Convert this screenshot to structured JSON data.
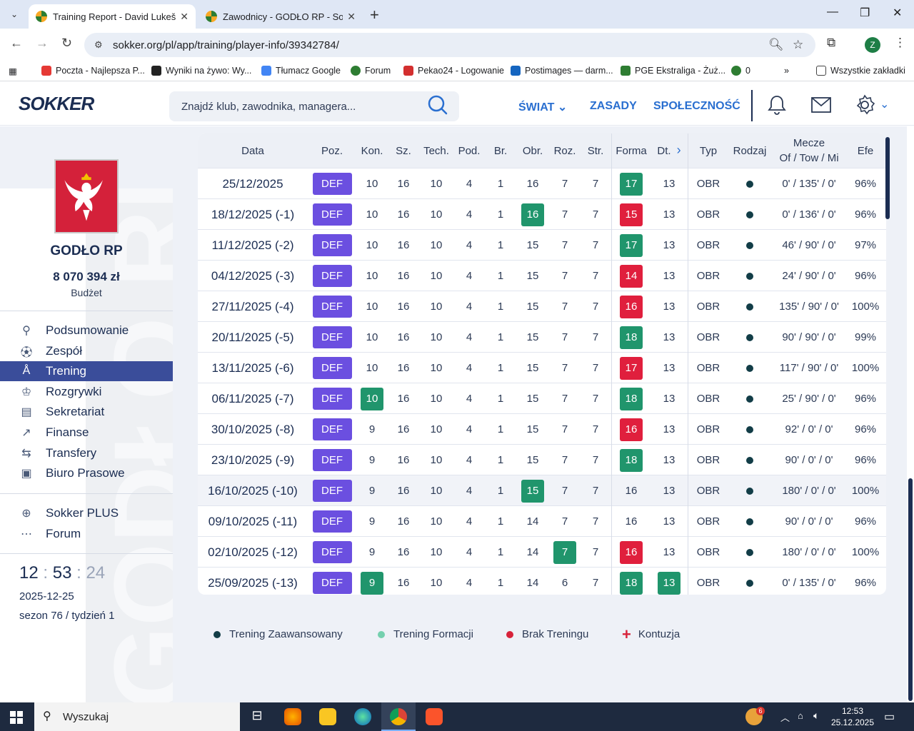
{
  "browser": {
    "tabs": [
      {
        "title": "Training Report - David Lukeš -"
      },
      {
        "title": "Zawodnicy - GODŁO RP - Sokk"
      }
    ],
    "url": "sokker.org/pl/app/training/player-info/39342784/",
    "profile_initial": "Z",
    "bookmarks": [
      {
        "label": "Poczta - Najlepsza P..."
      },
      {
        "label": "Wyniki na żywo: Wy..."
      },
      {
        "label": "Tłumacz Google"
      },
      {
        "label": "Forum"
      },
      {
        "label": "Pekao24 - Logowanie"
      },
      {
        "label": "Postimages — darm..."
      },
      {
        "label": "PGE Ekstraliga - Żuż..."
      },
      {
        "label": "0"
      }
    ],
    "all_bookmarks": "Wszystkie zakładki"
  },
  "site": {
    "logo": "SOKKER",
    "search_placeholder": "Znajdź klub, zawodnika, managera...",
    "nav": {
      "world": "ŚWIAT",
      "rules": "ZASADY",
      "community": "SPOŁECZNOŚĆ"
    }
  },
  "sidebar": {
    "club_name": "GODŁO RP",
    "budget_value": "8 070 394 zł",
    "budget_label": "Budżet",
    "watermark": "GODŁO RP",
    "menu": [
      {
        "label": "Podsumowanie",
        "icon": "summary-icon"
      },
      {
        "label": "Zespół",
        "icon": "ball-icon"
      },
      {
        "label": "Trening",
        "icon": "training-icon"
      },
      {
        "label": "Rozgrywki",
        "icon": "trophy-icon"
      },
      {
        "label": "Sekretariat",
        "icon": "office-icon"
      },
      {
        "label": "Finanse",
        "icon": "chart-icon"
      },
      {
        "label": "Transfery",
        "icon": "transfer-icon"
      },
      {
        "label": "Biuro Prasowe",
        "icon": "press-icon"
      }
    ],
    "extras": [
      {
        "label": "Sokker PLUS",
        "icon": "plus-circle-icon"
      },
      {
        "label": "Forum",
        "icon": "forum-icon"
      }
    ],
    "clock": {
      "h": "12",
      "m": "53",
      "s": "24"
    },
    "date": "2025-12-25",
    "season": "sezon 76 / tydzień 1"
  },
  "table": {
    "headers": {
      "date": "Data",
      "pos": "Poz.",
      "kon": "Kon.",
      "sz": "Sz.",
      "tech": "Tech.",
      "pod": "Pod.",
      "br": "Br.",
      "obr": "Obr.",
      "roz": "Roz.",
      "str": "Str.",
      "forma": "Forma",
      "dt": "Dt.",
      "typ": "Typ",
      "rodzaj": "Rodzaj",
      "mecze1": "Mecze",
      "mecze2": "Of / Tow / Mi",
      "efe": "Efe"
    },
    "rows": [
      {
        "date": "25/12/2025",
        "pos": "DEF",
        "kon": "10",
        "sz": "16",
        "tech": "10",
        "pod": "4",
        "br": "1",
        "obr": "16",
        "roz": "7",
        "str": "7",
        "forma": "17",
        "dt": "13",
        "typ": "OBR",
        "mecze": "0' / 135' / 0'",
        "efe": "96%",
        "hl": {
          "forma": "up"
        }
      },
      {
        "date": "18/12/2025 (-1)",
        "pos": "DEF",
        "kon": "10",
        "sz": "16",
        "tech": "10",
        "pod": "4",
        "br": "1",
        "obr": "16",
        "roz": "7",
        "str": "7",
        "forma": "15",
        "dt": "13",
        "typ": "OBR",
        "mecze": "0' / 136' / 0'",
        "efe": "96%",
        "hl": {
          "obr": "up",
          "forma": "down"
        }
      },
      {
        "date": "11/12/2025 (-2)",
        "pos": "DEF",
        "kon": "10",
        "sz": "16",
        "tech": "10",
        "pod": "4",
        "br": "1",
        "obr": "15",
        "roz": "7",
        "str": "7",
        "forma": "17",
        "dt": "13",
        "typ": "OBR",
        "mecze": "46' / 90' / 0'",
        "efe": "97%",
        "hl": {
          "forma": "up"
        }
      },
      {
        "date": "04/12/2025 (-3)",
        "pos": "DEF",
        "kon": "10",
        "sz": "16",
        "tech": "10",
        "pod": "4",
        "br": "1",
        "obr": "15",
        "roz": "7",
        "str": "7",
        "forma": "14",
        "dt": "13",
        "typ": "OBR",
        "mecze": "24' / 90' / 0'",
        "efe": "96%",
        "hl": {
          "forma": "down"
        }
      },
      {
        "date": "27/11/2025 (-4)",
        "pos": "DEF",
        "kon": "10",
        "sz": "16",
        "tech": "10",
        "pod": "4",
        "br": "1",
        "obr": "15",
        "roz": "7",
        "str": "7",
        "forma": "16",
        "dt": "13",
        "typ": "OBR",
        "mecze": "135' / 90' / 0'",
        "efe": "100%",
        "hl": {
          "forma": "down"
        }
      },
      {
        "date": "20/11/2025 (-5)",
        "pos": "DEF",
        "kon": "10",
        "sz": "16",
        "tech": "10",
        "pod": "4",
        "br": "1",
        "obr": "15",
        "roz": "7",
        "str": "7",
        "forma": "18",
        "dt": "13",
        "typ": "OBR",
        "mecze": "90' / 90' / 0'",
        "efe": "99%",
        "hl": {
          "forma": "up"
        }
      },
      {
        "date": "13/11/2025 (-6)",
        "pos": "DEF",
        "kon": "10",
        "sz": "16",
        "tech": "10",
        "pod": "4",
        "br": "1",
        "obr": "15",
        "roz": "7",
        "str": "7",
        "forma": "17",
        "dt": "13",
        "typ": "OBR",
        "mecze": "117' / 90' / 0'",
        "efe": "100%",
        "hl": {
          "forma": "down"
        }
      },
      {
        "date": "06/11/2025 (-7)",
        "pos": "DEF",
        "kon": "10",
        "sz": "16",
        "tech": "10",
        "pod": "4",
        "br": "1",
        "obr": "15",
        "roz": "7",
        "str": "7",
        "forma": "18",
        "dt": "13",
        "typ": "OBR",
        "mecze": "25' / 90' / 0'",
        "efe": "96%",
        "hl": {
          "kon": "up",
          "forma": "up"
        }
      },
      {
        "date": "30/10/2025 (-8)",
        "pos": "DEF",
        "kon": "9",
        "sz": "16",
        "tech": "10",
        "pod": "4",
        "br": "1",
        "obr": "15",
        "roz": "7",
        "str": "7",
        "forma": "16",
        "dt": "13",
        "typ": "OBR",
        "mecze": "92' / 0' / 0'",
        "efe": "96%",
        "hl": {
          "forma": "down"
        }
      },
      {
        "date": "23/10/2025 (-9)",
        "pos": "DEF",
        "kon": "9",
        "sz": "16",
        "tech": "10",
        "pod": "4",
        "br": "1",
        "obr": "15",
        "roz": "7",
        "str": "7",
        "forma": "18",
        "dt": "13",
        "typ": "OBR",
        "mecze": "90' / 0' / 0'",
        "efe": "96%",
        "hl": {
          "forma": "up"
        }
      },
      {
        "date": "16/10/2025 (-10)",
        "pos": "DEF",
        "kon": "9",
        "sz": "16",
        "tech": "10",
        "pod": "4",
        "br": "1",
        "obr": "15",
        "roz": "7",
        "str": "7",
        "forma": "16",
        "dt": "13",
        "typ": "OBR",
        "mecze": "180' / 0' / 0'",
        "efe": "100%",
        "hl": {
          "obr": "up"
        },
        "row_hl": true
      },
      {
        "date": "09/10/2025 (-11)",
        "pos": "DEF",
        "kon": "9",
        "sz": "16",
        "tech": "10",
        "pod": "4",
        "br": "1",
        "obr": "14",
        "roz": "7",
        "str": "7",
        "forma": "16",
        "dt": "13",
        "typ": "OBR",
        "mecze": "90' / 0' / 0'",
        "efe": "96%",
        "hl": {}
      },
      {
        "date": "02/10/2025 (-12)",
        "pos": "DEF",
        "kon": "9",
        "sz": "16",
        "tech": "10",
        "pod": "4",
        "br": "1",
        "obr": "14",
        "roz": "7",
        "str": "7",
        "forma": "16",
        "dt": "13",
        "typ": "OBR",
        "mecze": "180' / 0' / 0'",
        "efe": "100%",
        "hl": {
          "roz": "up",
          "forma": "down"
        }
      },
      {
        "date": "25/09/2025 (-13)",
        "pos": "DEF",
        "kon": "9",
        "sz": "16",
        "tech": "10",
        "pod": "4",
        "br": "1",
        "obr": "14",
        "roz": "6",
        "str": "7",
        "forma": "18",
        "dt": "13",
        "typ": "OBR",
        "mecze": "0' / 135' / 0'",
        "efe": "96%",
        "hl": {
          "kon": "up",
          "forma": "up",
          "dt": "up"
        }
      }
    ]
  },
  "legend": [
    {
      "label": "Trening Zaawansowany",
      "color": "#123d47",
      "kind": "dot"
    },
    {
      "label": "Trening Formacji",
      "color": "#74d0ae",
      "kind": "dot"
    },
    {
      "label": "Brak Treningu",
      "color": "#d7223a",
      "kind": "dot"
    },
    {
      "label": "Kontuzja",
      "color": "#d7223a",
      "kind": "cross"
    }
  ],
  "colors": {
    "up": "#20956c",
    "down": "#e01f3d",
    "position_badge": "#6b4fe0",
    "active_menu": "#3a4d9a"
  },
  "taskbar": {
    "search_placeholder": "Wyszukaj",
    "time": "12:53",
    "date": "25.12.2025",
    "notification_badge": "6"
  }
}
